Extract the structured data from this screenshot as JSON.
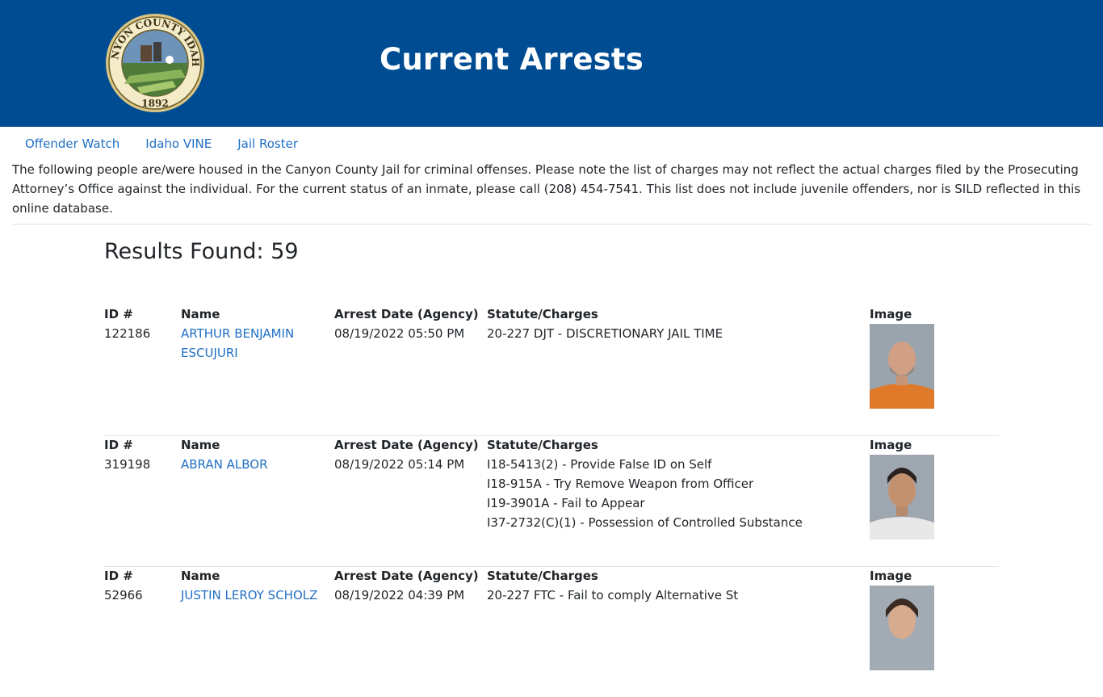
{
  "header": {
    "title": "Current Arrests",
    "seal": {
      "top_text": "CANYON COUNTY IDAHO",
      "year": "1892"
    }
  },
  "nav": [
    {
      "label": "Offender Watch"
    },
    {
      "label": "Idaho VINE"
    },
    {
      "label": "Jail Roster"
    }
  ],
  "intro": "The following people are/were housed in the Canyon County Jail for criminal offenses. Please note the list of charges may not reflect the actual charges filed by the Prosecuting Attorney’s Office against the individual. For the current status of an inmate, please call (208) 454-7541. This list does not include juvenile offenders, nor is SILD reflected in this online database.",
  "results": {
    "label": "Results Found: 59"
  },
  "columns": {
    "id": "ID #",
    "name": "Name",
    "date": "Arrest Date (Agency)",
    "charges": "Statute/Charges",
    "image": "Image"
  },
  "records": [
    {
      "id": "122186",
      "name": "ARTHUR BENJAMIN ESCUJURI",
      "date": "08/19/2022 05:50 PM",
      "charges": [
        "20-227 DJT - DISCRETIONARY JAIL TIME"
      ],
      "shirt_color": "#e07a2a",
      "bg_color": "#9aa4ad"
    },
    {
      "id": "319198",
      "name": "ABRAN ALBOR",
      "date": "08/19/2022 05:14 PM",
      "charges": [
        "I18-5413(2) - Provide False ID on Self",
        "I18-915A - Try Remove Weapon from Officer",
        "I19-3901A - Fail to Appear",
        "I37-2732(C)(1) - Possession of Controlled Substance"
      ],
      "shirt_color": "#e8e8e8",
      "bg_color": "#9ea7b0"
    },
    {
      "id": "52966",
      "name": "JUSTIN LEROY SCHOLZ",
      "date": "08/19/2022 04:39 PM",
      "charges": [
        "20-227 FTC - Fail to comply Alternative St"
      ],
      "shirt_color": "#c9c9c9",
      "bg_color": "#a2abb3"
    }
  ],
  "colors": {
    "header_bg": "#004c92",
    "link": "#1f6fc5",
    "divider": "#e3e3e3"
  }
}
